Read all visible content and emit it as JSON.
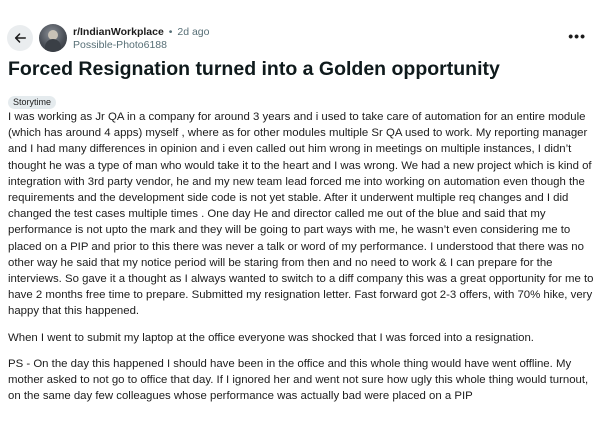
{
  "post": {
    "subreddit": "r/IndianWorkplace",
    "age": "2d ago",
    "author": "Possible-Photo6188",
    "title": "Forced Resignation turned into a Golden opportunity",
    "flair": "Storytime",
    "paragraphs": [
      "I was working as Jr QA in a company for around 3 years and i used to take care of automation for an entire module (which has around 4 apps) myself , where as for other modules multiple Sr QA used to work. My reporting manager and I had many differences in opinion and i even called out him wrong in meetings on multiple instances, I didn’t thought he was a type of man who would take it to the heart and I was wrong. We had a new project which is kind of integration with 3rd party vendor, he and my new team lead forced me into working on automation even though the requirements and the development side code is not yet stable. After it underwent multiple req changes and I did changed the test cases multiple times . One day He and director called me out of the blue and said that my performance is not upto the mark and they will be going to part ways with me, he wasn’t even considering me to placed on a PIP and prior to this there was never a talk or word of my performance. I understood that there was no other way he said that my notice period will be staring from then and no need to work & I can prepare for the interviews. So gave it a thought as I always wanted to switch to a diff company this was a great opportunity for me to have 2 months free time to prepare. Submitted my resignation letter. Fast forward got 2-3 offers, with 70% hike, very happy that this happened.",
      "When I went to submit my laptop at the office everyone was shocked that I was forced into a resignation.",
      "PS - On the day this happened I should have been in the office and this whole thing would have went offline. My mother asked to not go to office that day. If I ignored her and went not sure how ugly this whole thing would turnout, on the same day few colleagues whose performance was actually bad were placed on a PIP"
    ]
  },
  "icons": {
    "back": "arrow-left-icon",
    "more": "more-horizontal-icon"
  },
  "more_label": "•••"
}
